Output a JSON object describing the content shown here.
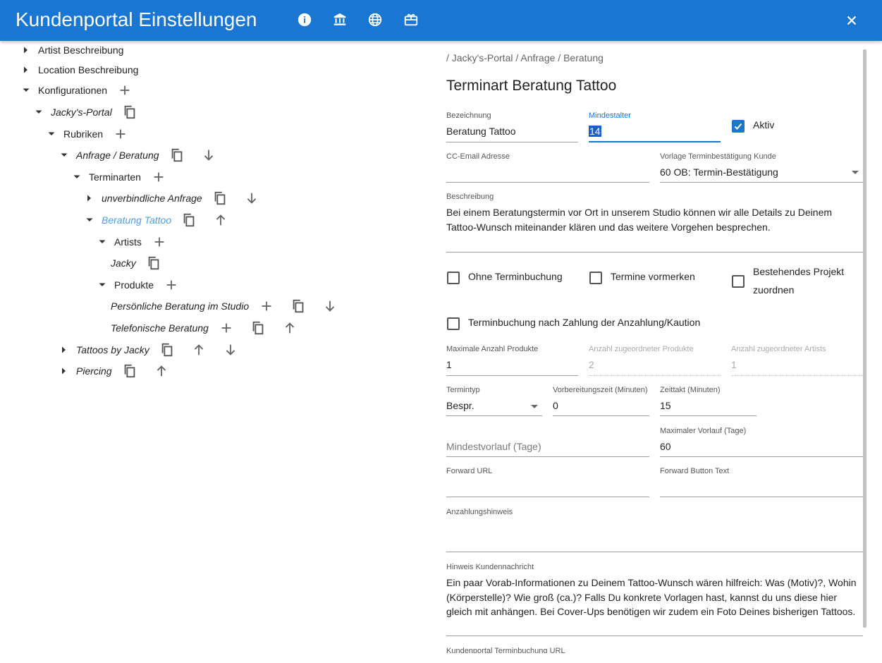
{
  "header": {
    "title": "Kundenportal Einstellungen"
  },
  "tree": [
    {
      "label": "Artist Beschreibung",
      "caret": "right",
      "italic": false
    },
    {
      "label": "Location Beschreibung",
      "caret": "right",
      "italic": false
    },
    {
      "label": "Konfigurationen",
      "caret": "down",
      "italic": false
    },
    {
      "label": "Jacky's-Portal",
      "caret": "down",
      "italic": true
    },
    {
      "label": "Rubriken",
      "caret": "down",
      "italic": false
    },
    {
      "label": "Anfrage / Beratung",
      "caret": "down",
      "italic": true
    },
    {
      "label": "Terminarten",
      "caret": "down",
      "italic": false
    },
    {
      "label": "unverbindliche Anfrage",
      "caret": "right",
      "italic": true
    },
    {
      "label": "Beratung Tattoo",
      "caret": "down",
      "italic": true,
      "selected": true
    },
    {
      "label": "Artists",
      "caret": "down",
      "italic": false
    },
    {
      "label": "Jacky",
      "caret": "none",
      "italic": true
    },
    {
      "label": "Produkte",
      "caret": "down",
      "italic": false
    },
    {
      "label": "Persönliche Beratung im Studio",
      "caret": "none",
      "italic": true
    },
    {
      "label": "Telefonische Beratung",
      "caret": "none",
      "italic": true
    },
    {
      "label": "Tattoos by Jacky",
      "caret": "right",
      "italic": true
    },
    {
      "label": "Piercing",
      "caret": "right",
      "italic": true
    }
  ],
  "form": {
    "breadcrumb": "/ Jacky's-Portal / Anfrage / Beratung",
    "title": "Terminart Beratung Tattoo",
    "bezeichnung": {
      "label": "Bezeichnung",
      "value": "Beratung Tattoo"
    },
    "mindestalter": {
      "label": "Mindestalter",
      "value": "14"
    },
    "aktiv": {
      "label": "Aktiv",
      "checked": true
    },
    "cc_email": {
      "label": "CC-Email Adresse",
      "value": ""
    },
    "vorlage": {
      "label": "Vorlage Terminbestätigung Kunde",
      "value": "60 OB: Termin-Bestätigung"
    },
    "beschreibung": {
      "label": "Beschreibung",
      "value": "Bei einem Beratungstermin vor Ort in unserem Studio können wir alle Details zu Deinem Tattoo-Wunsch miteinander klären und das weitere Vorgehen besprechen."
    },
    "ohne_terminbuchung": {
      "label": "Ohne Terminbuchung",
      "checked": false
    },
    "termine_vormerken": {
      "label": "Termine vormerken",
      "checked": false
    },
    "bestehendes_projekt": {
      "label": "Bestehendes Projekt zuordnen",
      "checked": false
    },
    "terminbuchung_zahlung": {
      "label": "Terminbuchung nach Zahlung der Anzahlung/Kaution",
      "checked": false
    },
    "max_produkte": {
      "label": "Maximale Anzahl Produkte",
      "value": "1"
    },
    "anz_produkte": {
      "label": "Anzahl zugeordneter Produkte",
      "value": "2"
    },
    "anz_artists": {
      "label": "Anzahl zugeordneter Artists",
      "value": "1"
    },
    "termintyp": {
      "label": "Termintyp",
      "value": "Bespr."
    },
    "vorbereitung": {
      "label": "Vorbereitungszeit (Minuten)",
      "value": "0"
    },
    "zeittakt": {
      "label": "Zeittakt (Minuten)",
      "value": "15"
    },
    "mindestvorlauf": {
      "placeholder": "Mindestvorlauf (Tage)"
    },
    "max_vorlauf": {
      "label": "Maximaler Vorlauf (Tage)",
      "value": "60"
    },
    "forward_url": {
      "label": "Forward URL",
      "value": ""
    },
    "forward_text": {
      "label": "Forward Button Text",
      "value": ""
    },
    "anzahlungshinweis": {
      "label": "Anzahlungshinweis",
      "value": ""
    },
    "hinweis": {
      "label": "Hinweis Kundennachricht",
      "value": "Ein paar Vorab-Informationen zu Deinem Tattoo-Wunsch wären hilfreich: Was (Motiv)?, Wohin (Körperstelle)? Wie groß (ca.)? Falls Du konkrete Vorlagen hast, kannst du uns diese hier gleich mit anhängen. Bei Cover-Ups benötigen wir zudem ein Foto Deines bisherigen Tattoos."
    },
    "kp_url": {
      "label": "Kundenportal Terminbuchung URL"
    }
  }
}
